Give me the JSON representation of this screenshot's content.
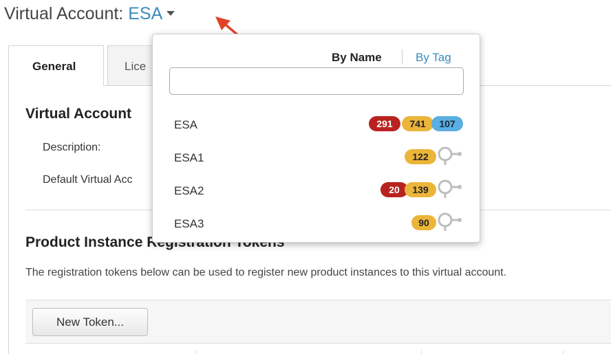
{
  "header": {
    "prefix": "Virtual Account:",
    "account": "ESA"
  },
  "tabs": [
    {
      "label": "General"
    },
    {
      "label": "Lice"
    }
  ],
  "main": {
    "section_title": "Virtual Account",
    "description_label": "Description:",
    "default_label": "Default Virtual Acc",
    "tokens_title": "Product Instance Registration Tokens",
    "tokens_desc": "The registration tokens below can be used to register new product instances to this virtual account.",
    "new_token_button": "New Token..."
  },
  "dropdown": {
    "sort_by_name": "By Name",
    "sort_by_tag": "By Tag",
    "search_value": "",
    "accounts": [
      {
        "name": "ESA",
        "red": "291",
        "yellow": "741",
        "blue": "107",
        "tag_icon": false
      },
      {
        "name": "ESA1",
        "red": "",
        "yellow": "122",
        "blue": "",
        "tag_icon": true
      },
      {
        "name": "ESA2",
        "red": "20",
        "yellow": "139",
        "blue": "",
        "tag_icon": true
      },
      {
        "name": "ESA3",
        "red": "",
        "yellow": "90",
        "blue": "",
        "tag_icon": true
      }
    ]
  },
  "colors": {
    "link": "#3a8bbd",
    "badge_red": "#b8231f",
    "badge_yellow": "#ebb53a",
    "badge_blue": "#5aaee2",
    "annotation_arrow": "#e0452c"
  },
  "icons": {
    "caret": "caret-down-icon",
    "tag": "tag-icon",
    "arrow": "annotation-arrow-icon"
  }
}
